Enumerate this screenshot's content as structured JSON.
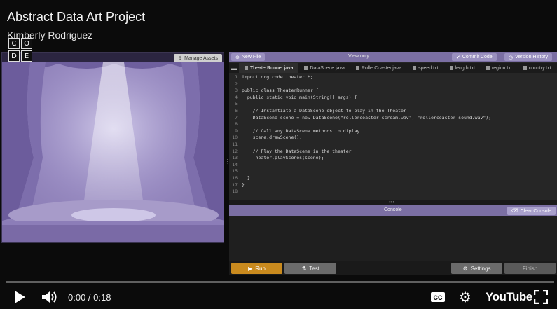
{
  "video": {
    "title": "Abstract Data Art Project",
    "channel": "Kimberly Rodriguez",
    "current_time": "0:00",
    "duration": "0:18",
    "time_display": "0:00 / 0:18",
    "progress_fraction": 0.0,
    "youtube_label": "YouTube"
  },
  "logo": {
    "letters": [
      "C",
      "O",
      "D",
      "E"
    ]
  },
  "stage": {
    "manage_assets_label": "Manage Assets",
    "colors": {
      "background": "#8e80b8",
      "curtain": "#7a6aa6",
      "floor": "#a79bc9"
    }
  },
  "editor": {
    "new_file_label": "New File",
    "view_only_label": "View only",
    "commit_label": "Commit Code",
    "version_history_label": "Version History",
    "tabs": [
      {
        "label": "TheaterRunner.java",
        "active": true
      },
      {
        "label": "DataScene.java",
        "active": false
      },
      {
        "label": "RollerCoaster.java",
        "active": false
      },
      {
        "label": "speed.txt",
        "active": false
      },
      {
        "label": "length.txt",
        "active": false
      },
      {
        "label": "region.txt",
        "active": false
      },
      {
        "label": "country.txt",
        "active": false
      }
    ],
    "code_lines": [
      {
        "n": "1",
        "text": "import org.code.theater.*;"
      },
      {
        "n": "2",
        "text": ""
      },
      {
        "n": "3",
        "text": "public class TheaterRunner {"
      },
      {
        "n": "4",
        "text": "  public static void main(String[] args) {"
      },
      {
        "n": "5",
        "text": ""
      },
      {
        "n": "6",
        "text": "    // Instantiate a DataScene object to play in the Theater"
      },
      {
        "n": "7",
        "text": "    DataScene scene = new DataScene(\"rollercoaster-scream.wav\", \"rollercoaster-sound.wav\");"
      },
      {
        "n": "8",
        "text": ""
      },
      {
        "n": "9",
        "text": "    // Call any DataScene methods to diplay"
      },
      {
        "n": "10",
        "text": "    scene.drawScene();"
      },
      {
        "n": "11",
        "text": ""
      },
      {
        "n": "12",
        "text": "    // Play the DataScene in the theater"
      },
      {
        "n": "13",
        "text": "    Theater.playScenes(scene);"
      },
      {
        "n": "14",
        "text": ""
      },
      {
        "n": "15",
        "text": ""
      },
      {
        "n": "16",
        "text": "  }"
      },
      {
        "n": "17",
        "text": "}"
      },
      {
        "n": "18",
        "text": ""
      }
    ]
  },
  "console": {
    "title": "Console",
    "clear_label": "Clear Console"
  },
  "actions": {
    "run_label": "Run",
    "test_label": "Test",
    "settings_label": "Settings",
    "finish_label": "Finish"
  },
  "colors": {
    "accent_purple": "#7b6fa3",
    "run_orange": "#c98a1e",
    "progress_red": "#ff0000"
  }
}
